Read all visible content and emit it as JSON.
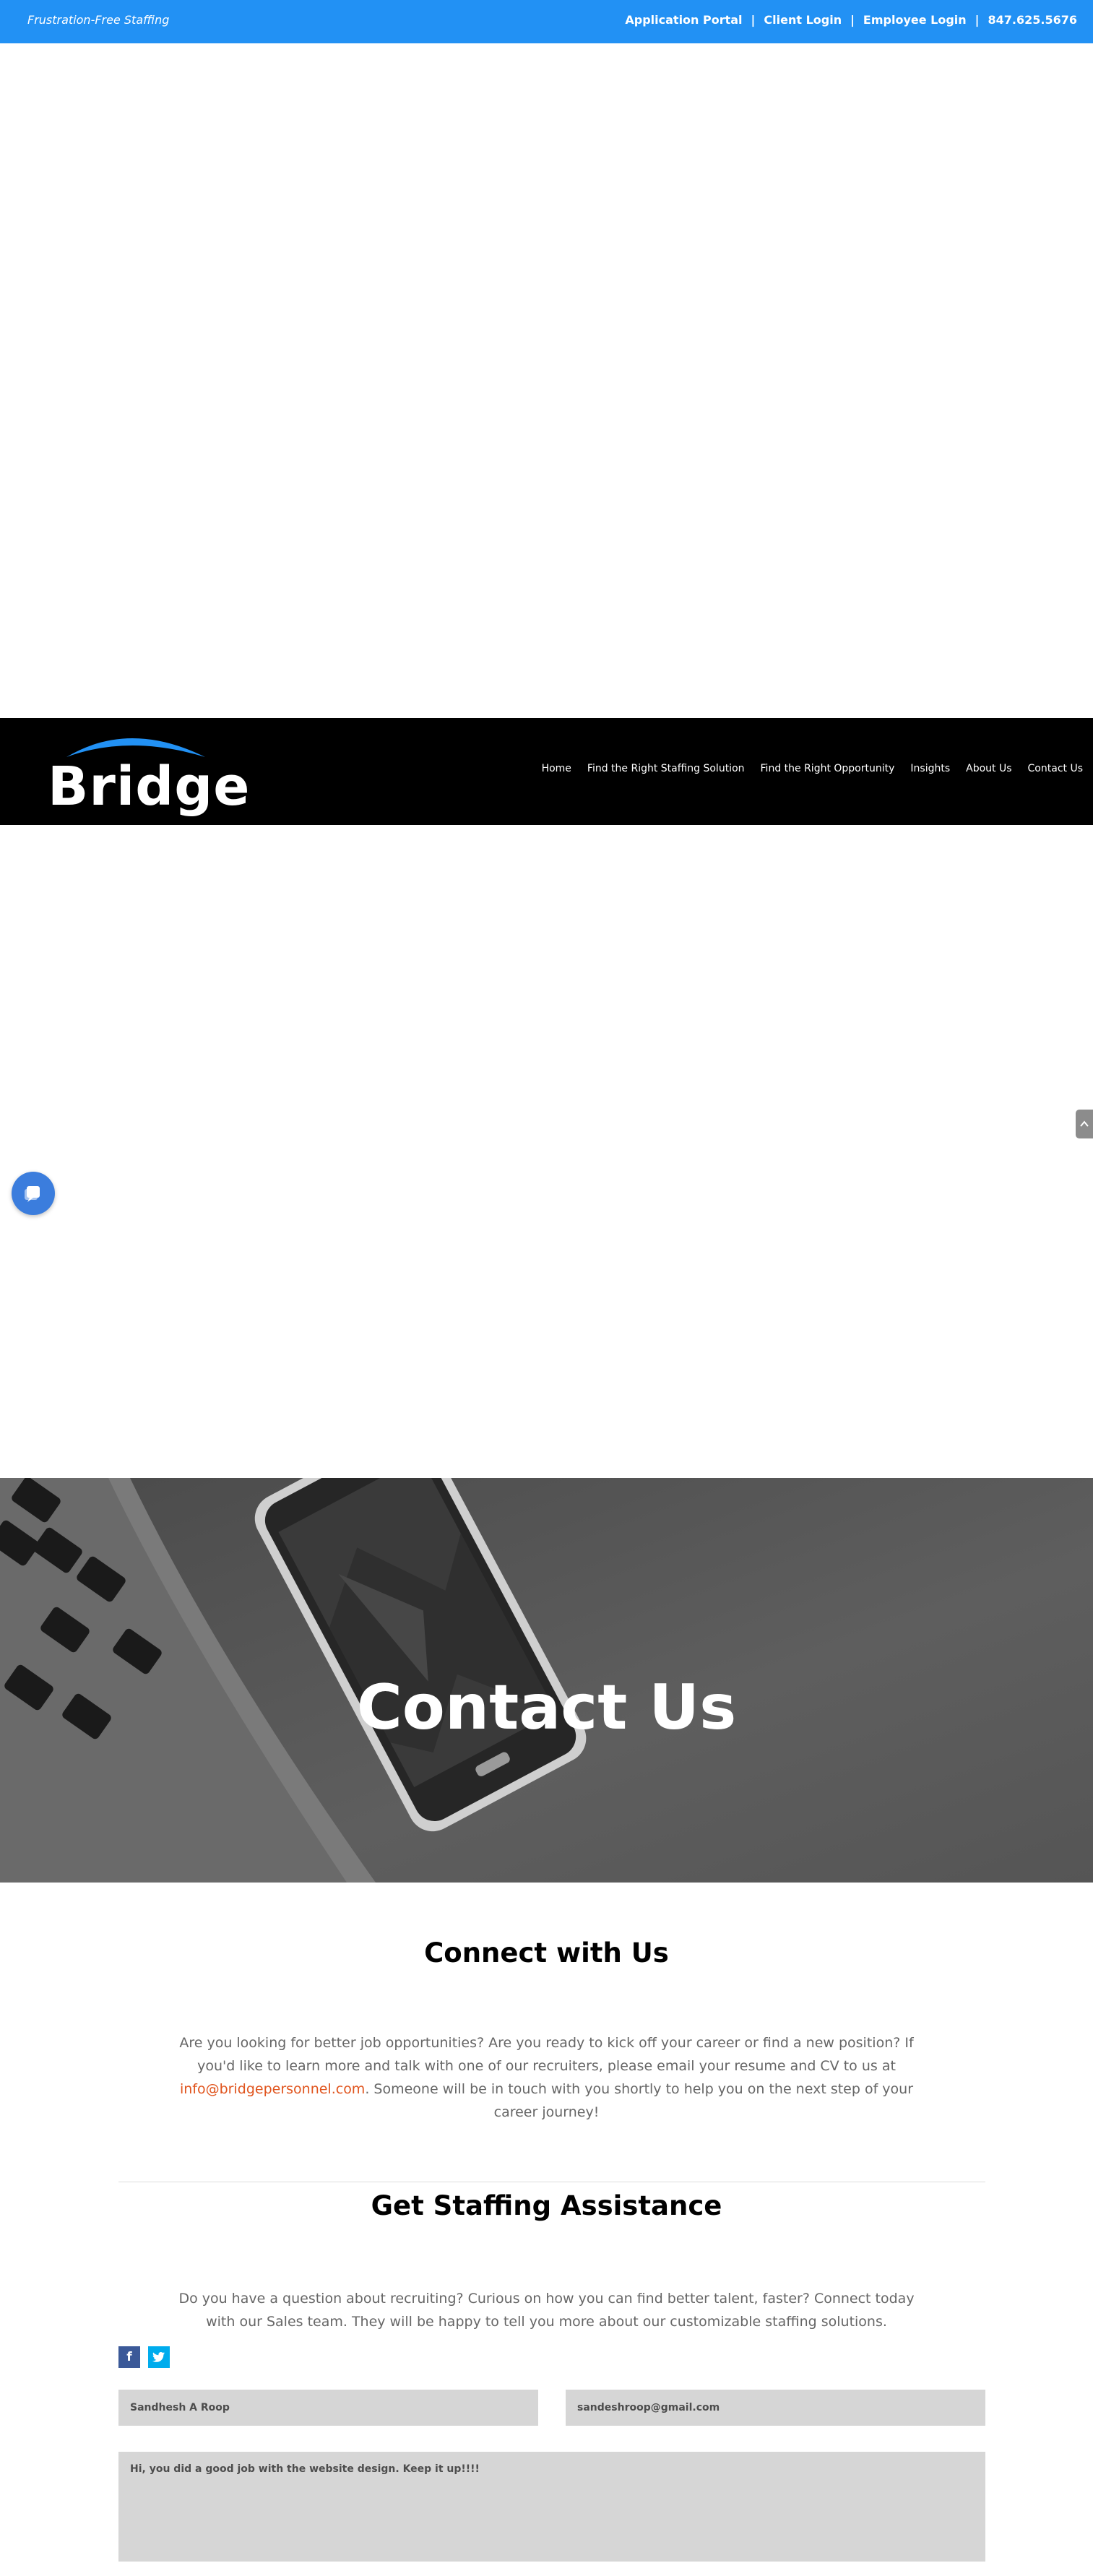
{
  "top_bar": {
    "tagline": "Frustration-Free Staffing",
    "links": [
      "Application Portal",
      "Client Login",
      "Employee Login",
      "847.625.5676"
    ],
    "separator": "|",
    "background_color": "#2291f4"
  },
  "nav": {
    "logo_text": "Bridge",
    "logo_accent_color": "#2291f4",
    "items": [
      "Home",
      "Find the Right Staffing Solution",
      "Find the Right Opportunity",
      "Insights",
      "About Us",
      "Contact Us"
    ]
  },
  "hero": {
    "title": "Contact Us"
  },
  "connect": {
    "title": "Connect with Us",
    "text_before": "Are you looking for better job opportunities? Are you ready to kick off your career or find a new position? If you'd like to learn more and talk with one of our recruiters, please email your resume and CV to us at ",
    "email": "info@bridgepersonnel.com",
    "text_after": ". Someone will be in touch with you shortly to help you on the next step of your career journey!",
    "link_color": "#e0541d"
  },
  "staffing": {
    "title": "Get Staffing Assistance",
    "text": "Do you have a question about recruiting? Curious on how you can find better talent, faster? Connect today with our Sales team. They will be happy to tell you more about our customizable staffing solutions."
  },
  "social": {
    "facebook": "f",
    "twitter_icon": "twitter-bird-icon",
    "facebook_color": "#3b5998",
    "twitter_color": "#00aced"
  },
  "form": {
    "name_value": "Sandhesh A Roop",
    "email_value": "sandeshroop@gmail.com",
    "message_value": "Hi, you did a good job with the website design. Keep it up!!!!"
  },
  "widgets": {
    "chat_icon": "chat-bubble-icon",
    "scroll_icon": "chevron-up-icon"
  }
}
